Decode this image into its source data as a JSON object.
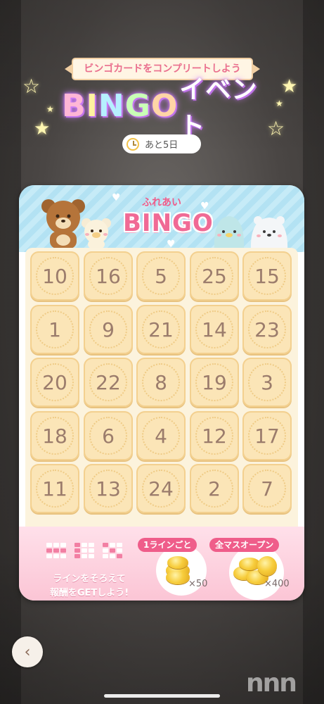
{
  "banner": {
    "text": "ビンゴカードをコンプリートしよう"
  },
  "title": {
    "parts": [
      "B",
      "I",
      "N",
      "G",
      "O"
    ],
    "suffix": "イベント"
  },
  "timer": {
    "text": "あと5日",
    "icon": "clock-icon"
  },
  "card": {
    "logo_small": "ふれあい",
    "logo_big": "BINGO",
    "numbers": [
      [
        10,
        16,
        5,
        25,
        15
      ],
      [
        1,
        9,
        21,
        14,
        23
      ],
      [
        20,
        22,
        8,
        19,
        3
      ],
      [
        18,
        6,
        4,
        12,
        17
      ],
      [
        11,
        13,
        24,
        2,
        7
      ]
    ]
  },
  "rewards": {
    "line_text_1": "ラインをそろえて",
    "line_text_2": "報酬をGETしよう!",
    "line_tag": "1ラインごと",
    "line_count": "×50",
    "all_tag": "全マスオープン",
    "all_count": "×400"
  },
  "nav": {
    "back_icon": "chevron-left-icon",
    "back_glyph": "‹"
  },
  "watermark": {
    "text": "nnn"
  },
  "colors": {
    "accent_pink": "#ef5d8a",
    "cell_fill": "#fbe5b7",
    "cell_text": "#9b7c6c"
  }
}
